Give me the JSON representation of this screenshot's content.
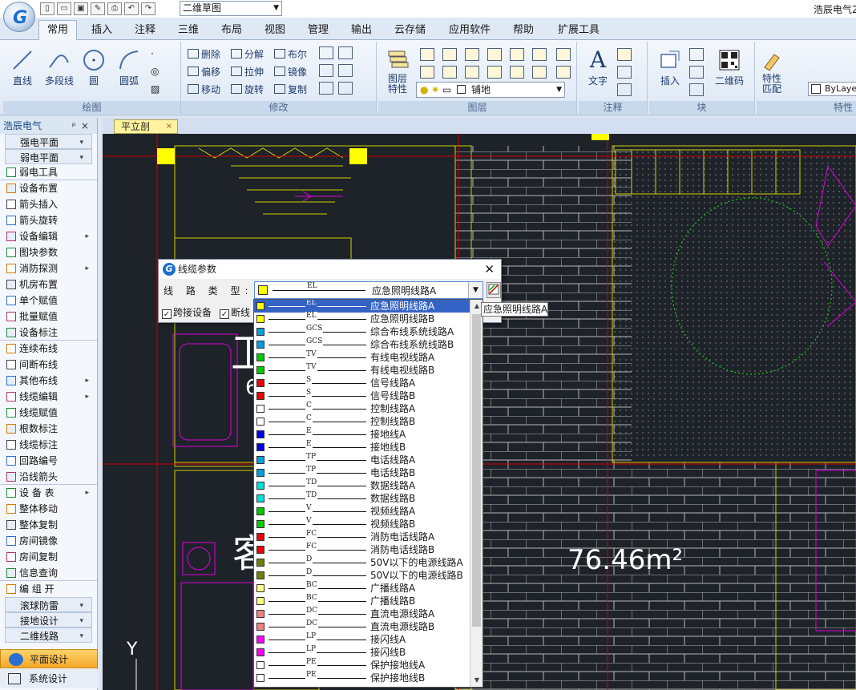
{
  "app": {
    "title": "浩辰电气2",
    "logo_letter": "G"
  },
  "workspace": {
    "selected": "二维草图"
  },
  "quick_access": [
    "new-icon",
    "open-icon",
    "save-icon",
    "saveas-icon",
    "print-icon",
    "undo-icon",
    "redo-icon"
  ],
  "tabs": [
    "常用",
    "插入",
    "注释",
    "三维",
    "布局",
    "视图",
    "管理",
    "输出",
    "云存储",
    "应用软件",
    "帮助",
    "扩展工具"
  ],
  "active_tab": "常用",
  "ribbon": {
    "draw": {
      "label": "绘图",
      "line": "直线",
      "polyline": "多段线",
      "circle": "圆",
      "arc": "圆弧"
    },
    "modify": {
      "label": "修改",
      "erase": "删除",
      "explode": "分解",
      "boolean": "布尔",
      "offset": "偏移",
      "stretch": "拉伸",
      "mirror": "镜像",
      "move": "移动",
      "rotate": "旋转",
      "copy": "复制"
    },
    "layer": {
      "label": "图层",
      "props": "图层\n特性",
      "current": "铺地"
    },
    "annotation": {
      "label": "注释",
      "text": "文字"
    },
    "block": {
      "label": "块",
      "insert": "插入",
      "qrcode": "二维码"
    },
    "properties": {
      "label": "特性",
      "match": "特性\n匹配",
      "bylayer": "ByLayer"
    }
  },
  "left_panel": {
    "title": "浩辰电气",
    "items": [
      {
        "label": "强电平面",
        "type": "head"
      },
      {
        "label": "弱电平面",
        "type": "head"
      },
      {
        "label": "弱电工具",
        "type": "sep"
      },
      {
        "label": "设备布置"
      },
      {
        "label": "箭头插入"
      },
      {
        "label": "箭头旋转"
      },
      {
        "label": "设备编辑",
        "type": "sub"
      },
      {
        "label": "图块参数"
      },
      {
        "label": "消防探测",
        "type": "sub"
      },
      {
        "label": "机房布置"
      },
      {
        "label": "单个赋值"
      },
      {
        "label": "批量赋值"
      },
      {
        "label": "设备标注",
        "type": "sep"
      },
      {
        "label": "连续布线"
      },
      {
        "label": "间断布线"
      },
      {
        "label": "其他布线",
        "type": "sub"
      },
      {
        "label": "线缆编辑",
        "type": "sub"
      },
      {
        "label": "线缆赋值"
      },
      {
        "label": "根数标注"
      },
      {
        "label": "线缆标注"
      },
      {
        "label": "回路编号"
      },
      {
        "label": "沿线箭头",
        "type": "sep"
      },
      {
        "label": "设 备 表",
        "type": "sub"
      },
      {
        "label": "整体移动"
      },
      {
        "label": "整体复制"
      },
      {
        "label": "房间镜像"
      },
      {
        "label": "房间复制"
      },
      {
        "label": "信息查询",
        "type": "sep"
      },
      {
        "label": "编 组 开"
      },
      {
        "label": "滚球防雷",
        "type": "head"
      },
      {
        "label": "接地设计",
        "type": "head"
      },
      {
        "label": "二维线路",
        "type": "head"
      }
    ],
    "bottom": [
      "平面设计",
      "系统设计"
    ]
  },
  "document_tab": "平立剖",
  "canvas": {
    "area_label": "76.46m²",
    "room_char_1": "卫",
    "room_char_2": "客",
    "axis_label": "Y",
    "room_digit": "6"
  },
  "dialog": {
    "title": "线缆参数",
    "line_type_label": "线 路 类 型:",
    "selected": {
      "code": "EL",
      "name": "应急照明线路A",
      "color": "#ffff00"
    },
    "checkbox_cross": "跨接设备",
    "checkbox_break": "断线",
    "tooltip": "应急照明线路A"
  },
  "line_types": [
    {
      "code": "EL",
      "name": "应急照明线路A",
      "color": "#ffff00"
    },
    {
      "code": "EL",
      "name": "应急照明线路B",
      "color": "#ffff00"
    },
    {
      "code": "GCS",
      "name": "综合布线系统线路A",
      "color": "#00a0e0"
    },
    {
      "code": "GCS",
      "name": "综合布线系统线路B",
      "color": "#00a0e0"
    },
    {
      "code": "TV",
      "name": "有线电视线路A",
      "color": "#00cc00"
    },
    {
      "code": "TV",
      "name": "有线电视线路B",
      "color": "#00cc00"
    },
    {
      "code": "S",
      "name": "信号线路A",
      "color": "#ee0000"
    },
    {
      "code": "S",
      "name": "信号线路B",
      "color": "#ee0000"
    },
    {
      "code": "C",
      "name": "控制线路A",
      "color": "#ffffff"
    },
    {
      "code": "C",
      "name": "控制线路B",
      "color": "#ffffff"
    },
    {
      "code": "E",
      "name": "接地线A",
      "color": "#0000ee"
    },
    {
      "code": "E",
      "name": "接地线B",
      "color": "#0000ee"
    },
    {
      "code": "TP",
      "name": "电话线路A",
      "color": "#00a0e0"
    },
    {
      "code": "TP",
      "name": "电话线路B",
      "color": "#00a0e0"
    },
    {
      "code": "TD",
      "name": "数据线路A",
      "color": "#00e0e0"
    },
    {
      "code": "TD",
      "name": "数据线路B",
      "color": "#00e0e0"
    },
    {
      "code": "V",
      "name": "视频线路A",
      "color": "#00cc00"
    },
    {
      "code": "V",
      "name": "视频线路B",
      "color": "#00cc00"
    },
    {
      "code": "FC",
      "name": "消防电话线路A",
      "color": "#ee0000"
    },
    {
      "code": "FC",
      "name": "消防电话线路B",
      "color": "#ee0000"
    },
    {
      "code": "D",
      "name": "50V以下的电源线路A",
      "color": "#708000"
    },
    {
      "code": "D",
      "name": "50V以下的电源线路B",
      "color": "#708000"
    },
    {
      "code": "BC",
      "name": "广播线路A",
      "color": "#ffff80"
    },
    {
      "code": "BC",
      "name": "广播线路B",
      "color": "#ffff80"
    },
    {
      "code": "DC",
      "name": "直流电源线路A",
      "color": "#f08080"
    },
    {
      "code": "DC",
      "name": "直流电源线路B",
      "color": "#f08080"
    },
    {
      "code": "LP",
      "name": "接闪线A",
      "color": "#ff00ff"
    },
    {
      "code": "LP",
      "name": "接闪线B",
      "color": "#ff00ff"
    },
    {
      "code": "PE",
      "name": "保护接地线A",
      "color": "#ffffff"
    },
    {
      "code": "PE",
      "name": "保护接地线B",
      "color": "#ffffff"
    }
  ]
}
